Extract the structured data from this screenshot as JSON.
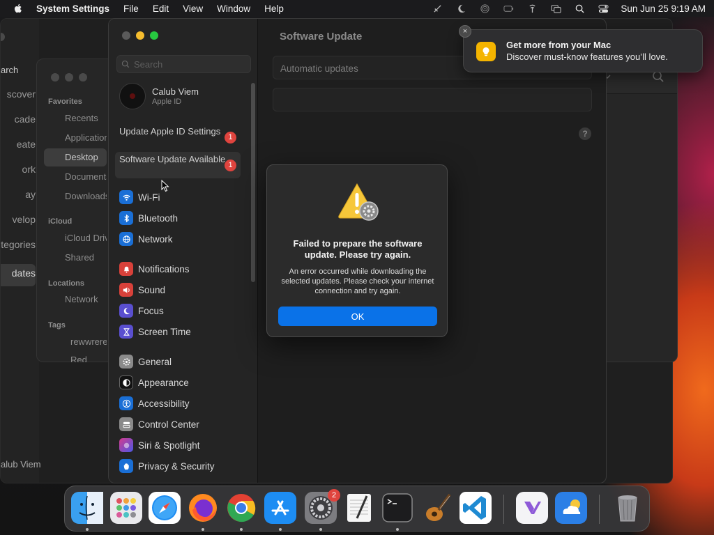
{
  "menubar": {
    "app_name": "System Settings",
    "menus": [
      "File",
      "Edit",
      "View",
      "Window",
      "Help"
    ],
    "clock": "Sun Jun 25  9:19 AM"
  },
  "finder_back": {
    "search_label": "arch",
    "nav_items": [
      "scover",
      "cade",
      "eate",
      "ork",
      "ay",
      "velop",
      "tegories",
      "dates"
    ],
    "user": "alub Viem"
  },
  "finder_mid": {
    "favorites_header": "Favorites",
    "favorites": [
      "Recents",
      "Applications",
      "Desktop",
      "Documents",
      "Downloads"
    ],
    "icloud_header": "iCloud",
    "icloud": [
      "iCloud Drive",
      "Shared"
    ],
    "locations_header": "Locations",
    "locations": [
      "Network"
    ],
    "tags_header": "Tags",
    "tags": [
      "rewwrerer",
      "Red"
    ]
  },
  "settings": {
    "search_placeholder": "Search",
    "user_name": "Calub Viem",
    "user_sub": "Apple ID",
    "alerts": [
      {
        "label": "Update Apple ID Settings",
        "badge": "1"
      },
      {
        "label": "Software Update Available",
        "badge": "1"
      }
    ],
    "sidebar": {
      "wifi": "Wi-Fi",
      "bluetooth": "Bluetooth",
      "network": "Network",
      "notifications": "Notifications",
      "sound": "Sound",
      "focus": "Focus",
      "screen_time": "Screen Time",
      "general": "General",
      "appearance": "Appearance",
      "accessibility": "Accessibility",
      "control_center": "Control Center",
      "siri": "Siri & Spotlight",
      "privacy": "Privacy & Security"
    },
    "page_title": "Software Update",
    "auto_updates_label": "Automatic updates",
    "help": "?"
  },
  "dialog": {
    "heading": "Failed to prepare the software update. Please try again.",
    "body": "An error occurred while downloading the selected updates. Please check your internet connection and try again.",
    "ok_label": "OK"
  },
  "notification": {
    "close": "×",
    "title": "Get more from your Mac",
    "body": "Discover must-know features you’ll love."
  },
  "dock": {
    "settings_badge": "2",
    "apps": [
      "finder-icon",
      "launchpad-icon",
      "safari-icon",
      "firefox-icon",
      "chrome-icon",
      "app-store-icon",
      "system-settings-icon",
      "textedit-icon",
      "terminal-icon",
      "garageband-icon",
      "vscode-icon",
      "visual-studio-icon",
      "weather-icon",
      "trash-icon"
    ]
  },
  "colors": {
    "accent": "#0a72e8",
    "badge_red": "#e0443e",
    "tip_yellow": "#f4b400"
  }
}
